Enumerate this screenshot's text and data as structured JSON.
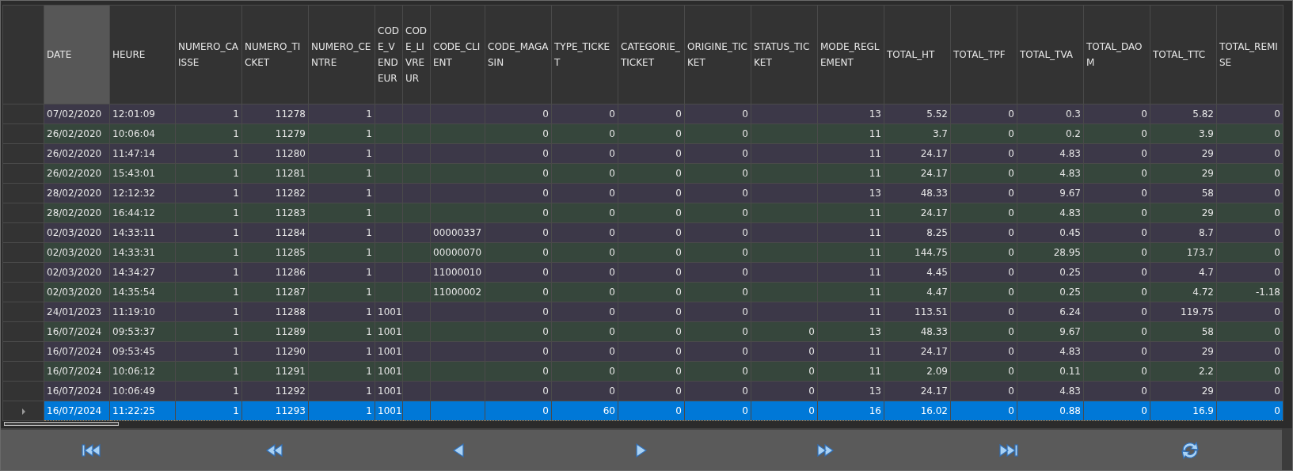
{
  "table": {
    "columns": [
      {
        "label": "DATE",
        "kind": "text",
        "selected": true
      },
      {
        "label": "HEURE",
        "kind": "text",
        "selected": false
      },
      {
        "label": "NUMERO_CAISSE",
        "kind": "number",
        "selected": false
      },
      {
        "label": "NUMERO_TICKET",
        "kind": "number",
        "selected": false
      },
      {
        "label": "NUMERO_CENTRE",
        "kind": "number",
        "selected": false
      },
      {
        "label": "CODE_VENDEUR",
        "kind": "text",
        "selected": false
      },
      {
        "label": "CODE_LIVREUR",
        "kind": "text",
        "selected": false
      },
      {
        "label": "CODE_CLIENT",
        "kind": "text",
        "selected": false
      },
      {
        "label": "CODE_MAGASIN",
        "kind": "number",
        "selected": false
      },
      {
        "label": "TYPE_TICKET",
        "kind": "number",
        "selected": false
      },
      {
        "label": "CATEGORIE_TICKET",
        "kind": "number",
        "selected": false
      },
      {
        "label": "ORIGINE_TICKET",
        "kind": "number",
        "selected": false
      },
      {
        "label": "STATUS_TICKET",
        "kind": "number",
        "selected": false
      },
      {
        "label": "MODE_REGLEMENT",
        "kind": "number",
        "selected": false
      },
      {
        "label": "TOTAL_HT",
        "kind": "number",
        "selected": false
      },
      {
        "label": "TOTAL_TPF",
        "kind": "number",
        "selected": false
      },
      {
        "label": "TOTAL_TVA",
        "kind": "number",
        "selected": false
      },
      {
        "label": "TOTAL_DAOM",
        "kind": "number",
        "selected": false
      },
      {
        "label": "TOTAL_TTC",
        "kind": "number",
        "selected": false
      },
      {
        "label": "TOTAL_REMISE",
        "kind": "number",
        "selected": false
      }
    ],
    "rows": [
      {
        "selected": false,
        "cells": [
          "07/02/2020",
          "12:01:09",
          "1",
          "11278",
          "1",
          null,
          null,
          null,
          "0",
          "0",
          "0",
          "0",
          null,
          "13",
          "5.52",
          "0",
          "0.3",
          "0",
          "5.82",
          "0"
        ]
      },
      {
        "selected": false,
        "cells": [
          "26/02/2020",
          "10:06:04",
          "1",
          "11279",
          "1",
          null,
          null,
          null,
          "0",
          "0",
          "0",
          "0",
          null,
          "11",
          "3.7",
          "0",
          "0.2",
          "0",
          "3.9",
          "0"
        ]
      },
      {
        "selected": false,
        "cells": [
          "26/02/2020",
          "11:47:14",
          "1",
          "11280",
          "1",
          null,
          null,
          null,
          "0",
          "0",
          "0",
          "0",
          null,
          "11",
          "24.17",
          "0",
          "4.83",
          "0",
          "29",
          "0"
        ]
      },
      {
        "selected": false,
        "cells": [
          "26/02/2020",
          "15:43:01",
          "1",
          "11281",
          "1",
          null,
          null,
          null,
          "0",
          "0",
          "0",
          "0",
          null,
          "11",
          "24.17",
          "0",
          "4.83",
          "0",
          "29",
          "0"
        ]
      },
      {
        "selected": false,
        "cells": [
          "28/02/2020",
          "12:12:32",
          "1",
          "11282",
          "1",
          null,
          null,
          null,
          "0",
          "0",
          "0",
          "0",
          null,
          "13",
          "48.33",
          "0",
          "9.67",
          "0",
          "58",
          "0"
        ]
      },
      {
        "selected": false,
        "cells": [
          "28/02/2020",
          "16:44:12",
          "1",
          "11283",
          "1",
          null,
          null,
          null,
          "0",
          "0",
          "0",
          "0",
          null,
          "11",
          "24.17",
          "0",
          "4.83",
          "0",
          "29",
          "0"
        ]
      },
      {
        "selected": false,
        "cells": [
          "02/03/2020",
          "14:33:11",
          "1",
          "11284",
          "1",
          null,
          null,
          "00000337",
          "0",
          "0",
          "0",
          "0",
          null,
          "11",
          "8.25",
          "0",
          "0.45",
          "0",
          "8.7",
          "0"
        ]
      },
      {
        "selected": false,
        "cells": [
          "02/03/2020",
          "14:33:31",
          "1",
          "11285",
          "1",
          null,
          null,
          "00000070",
          "0",
          "0",
          "0",
          "0",
          null,
          "11",
          "144.75",
          "0",
          "28.95",
          "0",
          "173.7",
          "0"
        ]
      },
      {
        "selected": false,
        "cells": [
          "02/03/2020",
          "14:34:27",
          "1",
          "11286",
          "1",
          null,
          null,
          "11000010",
          "0",
          "0",
          "0",
          "0",
          null,
          "11",
          "4.45",
          "0",
          "0.25",
          "0",
          "4.7",
          "0"
        ]
      },
      {
        "selected": false,
        "cells": [
          "02/03/2020",
          "14:35:54",
          "1",
          "11287",
          "1",
          null,
          null,
          "11000002",
          "0",
          "0",
          "0",
          "0",
          null,
          "11",
          "4.47",
          "0",
          "0.25",
          "0",
          "4.72",
          "-1.18"
        ]
      },
      {
        "selected": false,
        "cells": [
          "24/01/2023",
          "11:19:10",
          "1",
          "11288",
          "1",
          "1001",
          null,
          null,
          "0",
          "0",
          "0",
          "0",
          null,
          "11",
          "113.51",
          "0",
          "6.24",
          "0",
          "119.75",
          "0"
        ]
      },
      {
        "selected": false,
        "cells": [
          "16/07/2024",
          "09:53:37",
          "1",
          "11289",
          "1",
          "1001",
          null,
          null,
          "0",
          "0",
          "0",
          "0",
          "0",
          "13",
          "48.33",
          "0",
          "9.67",
          "0",
          "58",
          "0"
        ]
      },
      {
        "selected": false,
        "cells": [
          "16/07/2024",
          "09:53:45",
          "1",
          "11290",
          "1",
          "1001",
          null,
          null,
          "0",
          "0",
          "0",
          "0",
          "0",
          "11",
          "24.17",
          "0",
          "4.83",
          "0",
          "29",
          "0"
        ]
      },
      {
        "selected": false,
        "cells": [
          "16/07/2024",
          "10:06:12",
          "1",
          "11291",
          "1",
          "1001",
          null,
          null,
          "0",
          "0",
          "0",
          "0",
          "0",
          "11",
          "2.09",
          "0",
          "0.11",
          "0",
          "2.2",
          "0"
        ]
      },
      {
        "selected": false,
        "cells": [
          "16/07/2024",
          "10:06:49",
          "1",
          "11292",
          "1",
          "1001",
          null,
          null,
          "0",
          "0",
          "0",
          "0",
          "0",
          "13",
          "24.17",
          "0",
          "4.83",
          "0",
          "29",
          "0"
        ]
      },
      {
        "selected": true,
        "cells": [
          "16/07/2024",
          "11:22:25",
          "1",
          "11293",
          "1",
          "1001",
          null,
          null,
          "0",
          "60",
          "0",
          "0",
          "0",
          "16",
          "16.02",
          "0",
          "0.88",
          "0",
          "16.9",
          "0"
        ]
      }
    ]
  },
  "navigator": {
    "buttons": [
      {
        "kind": "first"
      },
      {
        "kind": "prev_page"
      },
      {
        "kind": "prev"
      },
      {
        "kind": "next"
      },
      {
        "kind": "next_page"
      },
      {
        "kind": "last"
      },
      {
        "kind": "refresh"
      }
    ]
  }
}
